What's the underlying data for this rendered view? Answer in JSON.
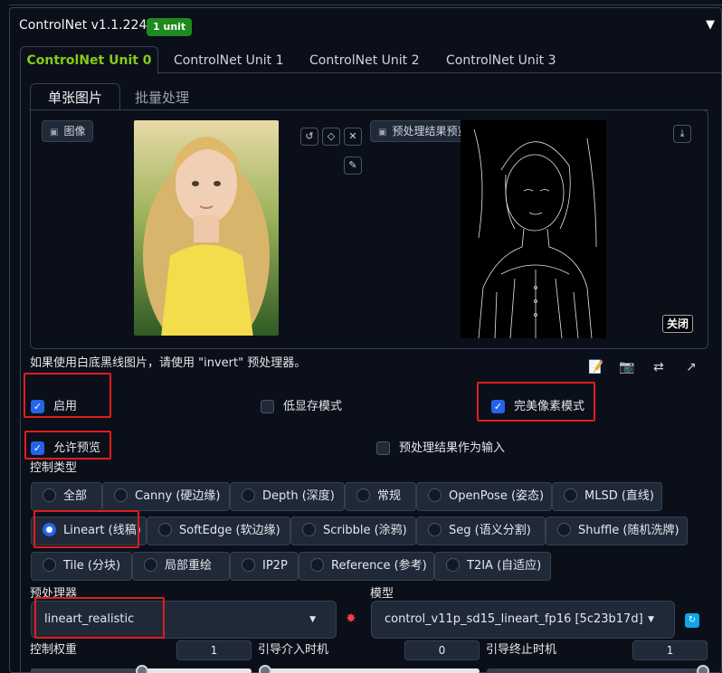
{
  "header": {
    "title": "ControlNet v1.1.224",
    "badge": "1 unit",
    "collapse_icon": "triangle-down-icon"
  },
  "unit_tabs": [
    "ControlNet Unit 0",
    "ControlNet Unit 1",
    "ControlNet Unit 2",
    "ControlNet Unit 3"
  ],
  "image_tabs": [
    "单张图片",
    "批量处理"
  ],
  "image_panel": {
    "input_label": "图像",
    "preview_label": "预处理结果预览",
    "close_label": "关闭"
  },
  "hint": "如果使用白底黑线图片，请使用 \"invert\" 预处理器。",
  "checkboxes": {
    "enable": {
      "label": "启用",
      "checked": true
    },
    "low_vram": {
      "label": "低显存模式",
      "checked": false
    },
    "pixel_perfect": {
      "label": "完美像素模式",
      "checked": true
    },
    "allow_preview": {
      "label": "允许预览",
      "checked": true
    },
    "preprocessed_input": {
      "label": "预处理结果作为输入",
      "checked": false
    }
  },
  "control_type": {
    "label": "控制类型",
    "options": [
      "全部",
      "Canny (硬边缘)",
      "Depth (深度)",
      "常规",
      "OpenPose (姿态)",
      "MLSD (直线)",
      "Lineart (线稿)",
      "SoftEdge (软边缘)",
      "Scribble (涂鸦)",
      "Seg (语义分割)",
      "Shuffle (随机洗牌)",
      "Tile (分块)",
      "局部重绘",
      "IP2P",
      "Reference (参考)",
      "T2IA (自适应)"
    ],
    "selected": "Lineart (线稿)"
  },
  "preprocessor": {
    "label": "预处理器",
    "value": "lineart_realistic"
  },
  "model": {
    "label": "模型",
    "value": "control_v11p_sd15_lineart_fp16 [5c23b17d]"
  },
  "sliders": {
    "weight": {
      "label": "控制权重",
      "value": "1"
    },
    "start": {
      "label": "引导介入时机",
      "value": "0"
    },
    "end": {
      "label": "引导终止时机",
      "value": "1"
    }
  },
  "colors": {
    "accent": "#2563eb",
    "active_tab": "#84cc16",
    "badge": "#1f8a1f",
    "highlight": "#e11d1d"
  }
}
